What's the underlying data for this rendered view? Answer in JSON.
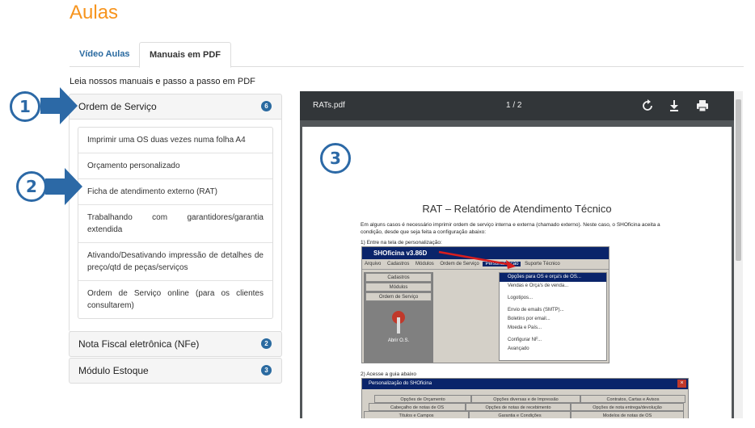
{
  "page": {
    "title": "Aulas",
    "intro": "Leia nossos manuais e passo a passo em PDF"
  },
  "tabs": [
    {
      "label": "Vídeo Aulas"
    },
    {
      "label": "Manuais em PDF"
    }
  ],
  "accordion": [
    {
      "title": "Ordem de Serviço",
      "count": "6",
      "items": [
        "Imprimir uma OS duas vezes numa folha A4",
        "Orçamento personalizado",
        "Ficha de atendimento externo (RAT)",
        "Trabalhando com garantidores/garantia extendida",
        "Ativando/Desativando impressão de detalhes de preço/qtd de peças/serviços",
        "Ordem de Serviço online (para os clientes consultarem)"
      ]
    },
    {
      "title": "Nota Fiscal eletrônica (NFe)",
      "count": "2"
    },
    {
      "title": "Módulo Estoque",
      "count": "3"
    }
  ],
  "callouts": [
    "1",
    "2",
    "3"
  ],
  "viewer": {
    "filename": "RATs.pdf",
    "page_indicator": "1 / 2",
    "icons": [
      "rotate-icon",
      "download-icon",
      "print-icon"
    ]
  },
  "pdf": {
    "title": "RAT – Relatório de Atendimento Técnico",
    "paragraph1": "Em alguns casos é necessário imprimir ordem de serviço interna e externa (chamado externo). Neste caso, o SHOficina aceita a condição, desde que seja feita a configuração abaixo:",
    "step1": "1) Entre na tela de personalização:",
    "step2": "2) Acesse a guia abaixo",
    "app_title": "SHOficina v3.86D",
    "menu": [
      "Arquivo",
      "Cadastros",
      "Módulos",
      "Ordem de Serviço",
      "Personalização",
      "Suporte Técnico"
    ],
    "left_buttons": [
      "Cadastros",
      "Módulos",
      "Ordem de Serviço"
    ],
    "left_label": "Abrir O.S.",
    "dropdown": [
      "Opções para OS e orça's de OS...",
      "Vendas e Orça's de venda...",
      "Logotipos...",
      "Envio de emails (SMTP)...",
      "Boletins por email...",
      "Moeda e País...",
      "Configurar NF...",
      "Avançado"
    ],
    "dialog_title": "Personalização do SHOficina",
    "dialog_tabs_row1": [
      "Opções de Orçamento",
      "Opções diversas e de Impressão",
      "Contratos, Cartas e Avisos"
    ],
    "dialog_tabs_row2": [
      "Cabeçalho de notas de OS",
      "Opções de notas de recebimento",
      "Opções de nota entrega/devolução"
    ],
    "dialog_tabs_row3": [
      "Títulos e Campos",
      "Garantia e Condições",
      "Modelos de notas de OS"
    ]
  },
  "colors": {
    "accent": "#f7941d",
    "primary": "#2a6aa0",
    "callout": "#2c69a6"
  }
}
